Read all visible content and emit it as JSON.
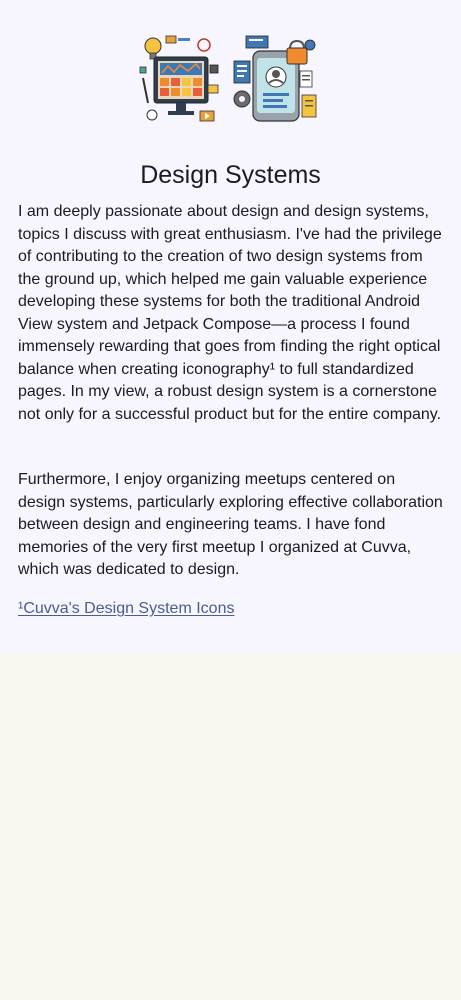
{
  "article": {
    "title": "Design Systems",
    "paragraphs": [
      "I am deeply passionate about design and design systems, topics I discuss with great enthusiasm. I've had the privilege of contributing to the creation of two design systems from the ground up, which helped me gain valuable experience developing these systems for both the traditional Android View system and Jetpack Compose—a process I found immensely rewarding that goes from finding the right optical balance when creating iconography¹ to full standardized pages. In my view, a robust design system is a cornerstone not only for a successful product but for the entire company.",
      "Furthermore, I enjoy organizing meetups centered on design systems, particularly exploring effective collaboration between design and engineering teams. I have fond memories of the very first meetup I organized at Cuvva, which was dedicated to design."
    ],
    "footnote_link": "¹Cuvva's Design System Icons"
  },
  "colors": {
    "card_background": "#f7f5fd",
    "page_background": "#f8f8f0",
    "text": "#1c1b1f",
    "link": "#4a5d8e"
  },
  "icons": [
    "design-systems-illustration",
    "lightbulb-icon",
    "monitor-icon",
    "smartphone-icon",
    "padlock-icon",
    "gear-icon"
  ]
}
